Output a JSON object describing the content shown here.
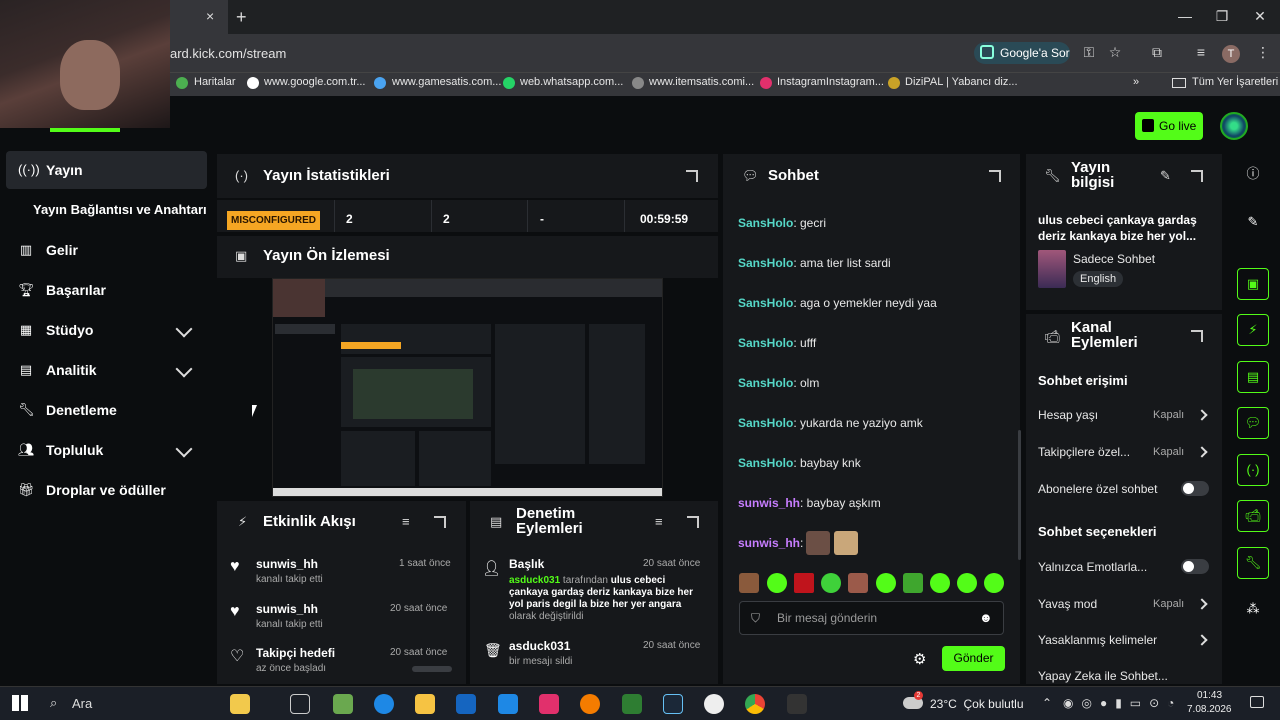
{
  "browser": {
    "url": "ard.kick.com/stream",
    "tab_close": "×",
    "new_tab": "+",
    "google_sor": "Google'a Sor",
    "bookmarks": [
      "Haritalar",
      "www.google.com.tr...",
      "www.gamesatis.com...",
      "web.whatsapp.com...",
      "www.itemsatis.comi...",
      "InstagramInstagram...",
      "DiziPAL | Yabancı diz..."
    ],
    "more": "»",
    "all_bookmarks": "Tüm Yer İşaretleri",
    "profile_initial": "T",
    "win_min": "—",
    "win_max": "❐",
    "win_close": "✕"
  },
  "header": {
    "go_live": "Go live"
  },
  "sidebar": {
    "items": [
      {
        "label": "Yayın",
        "icon": "broadcast-icon"
      },
      {
        "label": "Yayın Bağlantısı ve Anahtarı",
        "icon": ""
      },
      {
        "label": "Gelir",
        "icon": "chart-icon"
      },
      {
        "label": "Başarılar",
        "icon": "trophy-icon"
      },
      {
        "label": "Stüdyo",
        "icon": "studio-icon"
      },
      {
        "label": "Analitik",
        "icon": "analytics-icon"
      },
      {
        "label": "Denetleme",
        "icon": "wrench-icon"
      },
      {
        "label": "Topluluk",
        "icon": "community-icon"
      },
      {
        "label": "Droplar ve ödüller",
        "icon": "gift-icon"
      }
    ]
  },
  "stats": {
    "title": "Yayın İstatistikleri",
    "status": "MISCONFIGURED",
    "viewers": "2",
    "followers": "2",
    "subs": "-",
    "duration": "00:59:59"
  },
  "preview": {
    "title": "Yayın Ön İzlemesi"
  },
  "activity": {
    "title": "Etkinlik Akışı",
    "items": [
      {
        "user": "sunwis_hh",
        "desc": "kanalı takip etti",
        "time": "1 saat önce"
      },
      {
        "user": "sunwis_hh",
        "desc": "kanalı takip etti",
        "time": "20 saat önce"
      },
      {
        "user": "Takipçi hedefi",
        "desc": "az önce başladı",
        "time": "20 saat önce"
      }
    ]
  },
  "moderation": {
    "title1": "Denetim",
    "title2": "Eylemleri",
    "items": [
      {
        "head": "Başlık",
        "time": "20 saat önce",
        "user": "asduck031",
        "mid": " tarafından ",
        "bold": "ulus cebeci çankaya gardaş deriz kankaya bize her yol paris degil la bize her yer angara",
        "tail": "olarak değiştirildi"
      },
      {
        "head": "asduck031",
        "time": "20 saat önce",
        "desc": "bir mesajı sildi"
      }
    ]
  },
  "chat": {
    "title": "Sohbet",
    "messages": [
      {
        "user": "SansHolo",
        "text": ": gecri",
        "color": "#56d8c8"
      },
      {
        "user": "SansHolo",
        "text": ": ama tier list sardi",
        "color": "#56d8c8"
      },
      {
        "user": "SansHolo",
        "text": ": aga o yemekler neydi yaa",
        "color": "#56d8c8"
      },
      {
        "user": "SansHolo",
        "text": ": ufff",
        "color": "#56d8c8"
      },
      {
        "user": "SansHolo",
        "text": ": olm",
        "color": "#56d8c8"
      },
      {
        "user": "SansHolo",
        "text": ": yukarda ne yaziyo amk",
        "color": "#56d8c8"
      },
      {
        "user": "SansHolo",
        "text": ": baybay knk",
        "color": "#56d8c8"
      },
      {
        "user": "sunwis_hh",
        "text": ": baybay aşkım",
        "color": "#c77dff"
      },
      {
        "user": "sunwis_hh",
        "text": ":",
        "color": "#c77dff"
      }
    ],
    "placeholder": "Bir mesaj gönderin",
    "send": "Gönder"
  },
  "info": {
    "title1": "Yayın",
    "title2": "bilgisi",
    "stream_title": "ulus cebeci çankaya gardaş deriz kankaya bize her yol...",
    "category": "Sadece Sohbet",
    "language": "English"
  },
  "channel": {
    "title1": "Kanal",
    "title2": "Eylemleri",
    "chat_access": "Sohbet erişimi",
    "rows1": [
      {
        "label": "Hesap yaşı",
        "value": "Kapalı"
      },
      {
        "label": "Takipçilere özel...",
        "value": "Kapalı"
      },
      {
        "label": "Abonelere özel sohbet",
        "value": ""
      }
    ],
    "chat_options": "Sohbet seçenekleri",
    "rows2": [
      {
        "label": "Yalnızca Emotlarla...",
        "value": ""
      },
      {
        "label": "Yavaş mod",
        "value": "Kapalı"
      },
      {
        "label": "Yasaklanmış kelimeler",
        "value": ""
      },
      {
        "label": "Yapay Zeka ile Sohbet...",
        "value": ""
      }
    ]
  },
  "taskbar": {
    "search": "Ara",
    "weather": "23°C  Çok bulutlu",
    "time": "01:43",
    "date": "7.08.2026",
    "badge": "2"
  },
  "colors": {
    "accent": "#53fc18",
    "misconfigured": "#f5a623"
  }
}
